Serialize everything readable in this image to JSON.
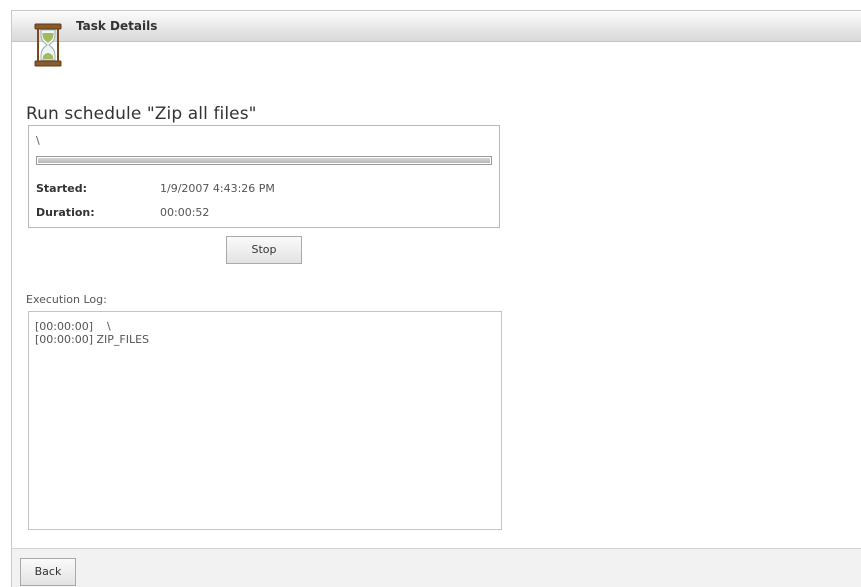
{
  "window": {
    "title": "Task Details"
  },
  "task": {
    "heading": "Run schedule \"Zip all files\"",
    "current_path": "\\",
    "progress_fraction": 1.0,
    "started_label": "Started:",
    "started_value": "1/9/2007 4:43:26 PM",
    "duration_label": "Duration:",
    "duration_value": "00:00:52"
  },
  "buttons": {
    "stop_label": "Stop",
    "back_label": "Back"
  },
  "log": {
    "label": "Execution Log:",
    "lines": [
      "[00:00:00]    \\",
      "[00:00:00] ZIP_FILES"
    ]
  },
  "icons": {
    "task_icon": "hourglass-icon"
  }
}
